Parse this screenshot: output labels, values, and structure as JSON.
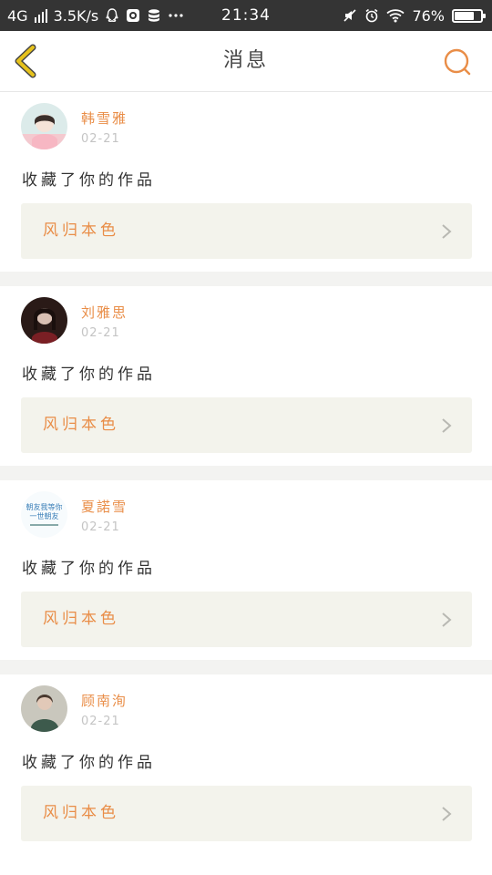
{
  "status_bar": {
    "network": "4G",
    "speed": "3.5K/s",
    "time": "21:34",
    "battery": "76%",
    "battery_level": 0.76,
    "icons": [
      "qq-icon",
      "app-icon",
      "storage-icon",
      "more-dots-icon",
      "mute-icon",
      "alarm-icon",
      "wifi-icon",
      "battery-icon"
    ]
  },
  "header": {
    "title": "消息",
    "back_icon": "chevron-left-icon",
    "search_icon": "search-icon"
  },
  "colors": {
    "accent": "#e98d47",
    "back_arrow": "#e6c21c",
    "work_bg": "#f3f3ec"
  },
  "messages": [
    {
      "user": "韩雪雅",
      "date": "02-21",
      "action": "收藏了你的作品",
      "work": "风归本色"
    },
    {
      "user": "刘雅思",
      "date": "02-21",
      "action": "收藏了你的作品",
      "work": "风归本色"
    },
    {
      "user": "夏諾雪",
      "date": "02-21",
      "action": "收藏了你的作品",
      "work": "风归本色",
      "avatar_text": "朝友我等你一世朝友"
    },
    {
      "user": "顾南洵",
      "date": "02-21",
      "action": "收藏了你的作品",
      "work": "风归本色"
    }
  ]
}
